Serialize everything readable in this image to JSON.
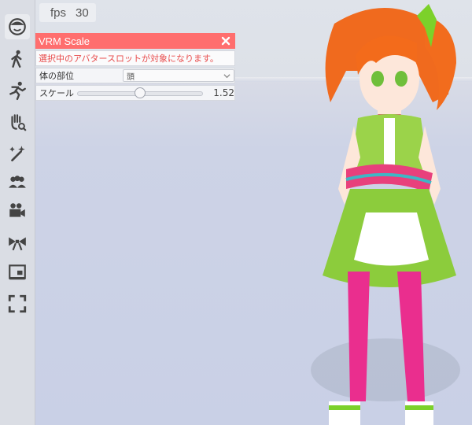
{
  "fps": {
    "label": "fps",
    "value": "30"
  },
  "sidebar": {
    "items": [
      {
        "icon": "face-icon",
        "label": ""
      },
      {
        "icon": "walking-person-icon",
        "label": ""
      },
      {
        "icon": "running-person-icon",
        "label": ""
      },
      {
        "icon": "hand-search-icon",
        "label": ""
      },
      {
        "icon": "magic-wand-icon",
        "label": ""
      },
      {
        "icon": "group-icon",
        "label": ""
      },
      {
        "icon": "video-camera-icon",
        "label": ""
      },
      {
        "icon": "bow-ribbon-icon",
        "label": ""
      },
      {
        "icon": "display-icon",
        "label": ""
      },
      {
        "icon": "fullscreen-icon",
        "label": ""
      }
    ]
  },
  "panel": {
    "title": "VRM Scale",
    "notice": "選択中のアバタースロットが対象になります。",
    "body_part_label": "体の部位",
    "body_part_value": "頭",
    "scale_label": "スケール",
    "scale_value": "1.52",
    "scale_fraction": 0.5
  },
  "colors": {
    "header": "#ff6e6e",
    "notice_text": "#e84c4c"
  }
}
